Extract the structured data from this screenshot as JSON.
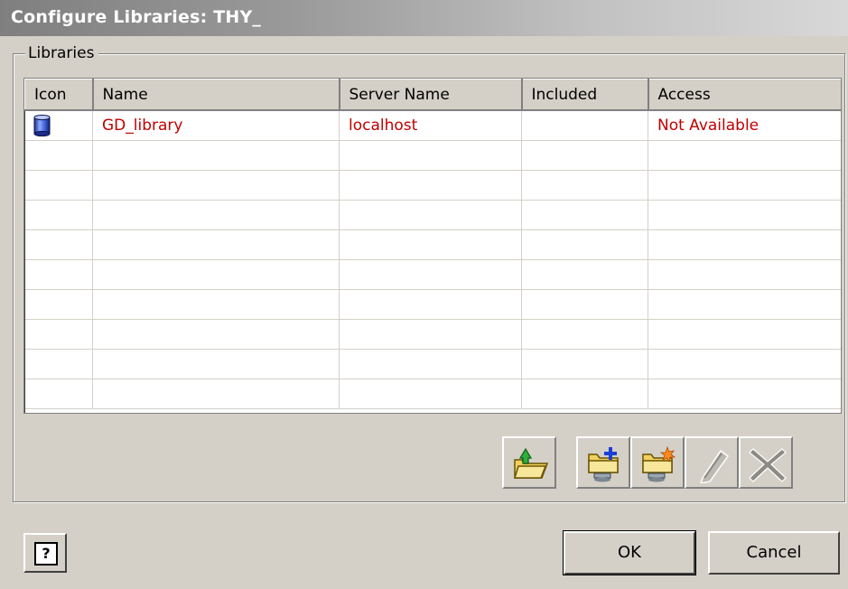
{
  "window": {
    "title": "Configure Libraries: THY_"
  },
  "libraries_group": {
    "label": "Libraries"
  },
  "table": {
    "columns": [
      "Icon",
      "Name",
      "Server Name",
      "Included",
      "Access"
    ],
    "rows": [
      {
        "icon": "database-icon",
        "name": "GD_library",
        "server": "localhost",
        "included": "",
        "access": "Not Available"
      }
    ],
    "row_text_color": "#c00000"
  },
  "toolbar": {
    "buttons": [
      {
        "icon": "open-folder-arrow-icon"
      },
      {
        "icon": "add-library-icon"
      },
      {
        "icon": "new-library-icon"
      },
      {
        "icon": "edit-pencil-icon",
        "disabled": true
      },
      {
        "icon": "delete-x-icon",
        "disabled": true
      }
    ]
  },
  "footer": {
    "help_label": "?",
    "ok_label": "OK",
    "cancel_label": "Cancel"
  }
}
